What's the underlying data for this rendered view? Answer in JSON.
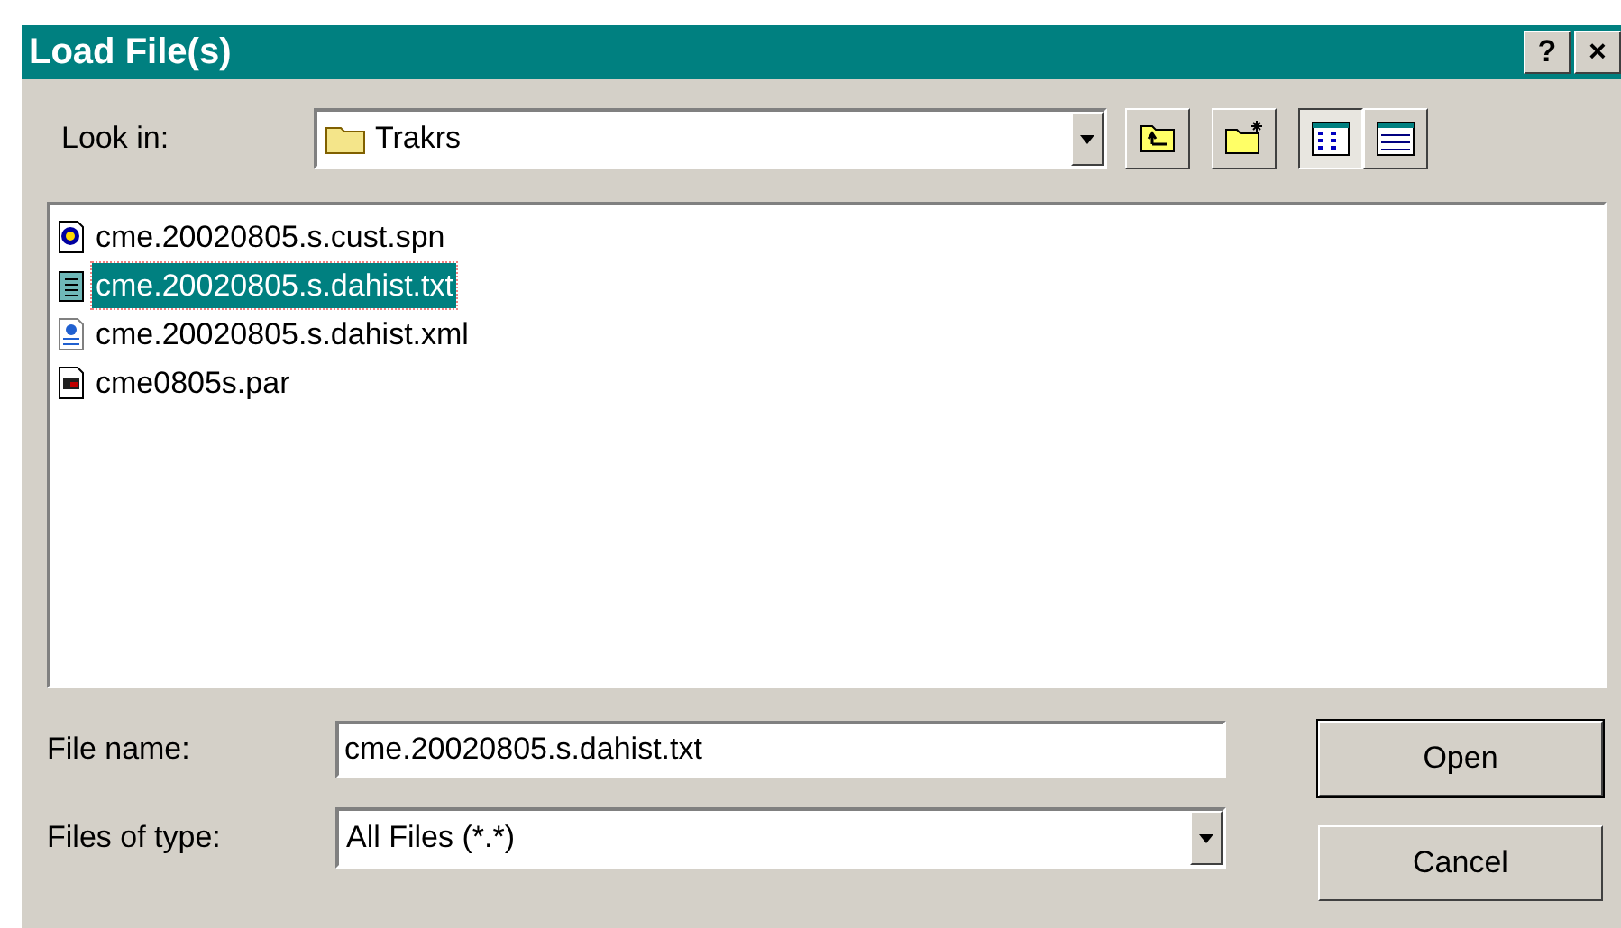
{
  "window": {
    "title": "Load File(s)",
    "controls": [
      "?",
      "×"
    ]
  },
  "look_in": {
    "label": "Look in:",
    "value": "Trakrs"
  },
  "toolbar": [
    {
      "kind": "up"
    },
    {
      "kind": "newfolder"
    },
    {
      "kind": "list",
      "selected": true
    },
    {
      "kind": "details",
      "selected": false
    }
  ],
  "files": [
    {
      "name": "cme.20020805.s.cust.spn",
      "kind": "spn",
      "selected": false
    },
    {
      "name": "cme.20020805.s.dahist.txt",
      "kind": "txt",
      "selected": true
    },
    {
      "name": "cme.20020805.s.dahist.xml",
      "kind": "xml",
      "selected": false
    },
    {
      "name": "cme0805s.par",
      "kind": "par",
      "selected": false
    }
  ],
  "file_name": {
    "label": "File name:",
    "value": "cme.20020805.s.dahist.txt"
  },
  "file_type": {
    "label": "Files of type:",
    "value": "All Files (*.*)"
  },
  "buttons": [
    {
      "label": "Open",
      "default": true
    },
    {
      "label": "Cancel",
      "default": false
    }
  ]
}
